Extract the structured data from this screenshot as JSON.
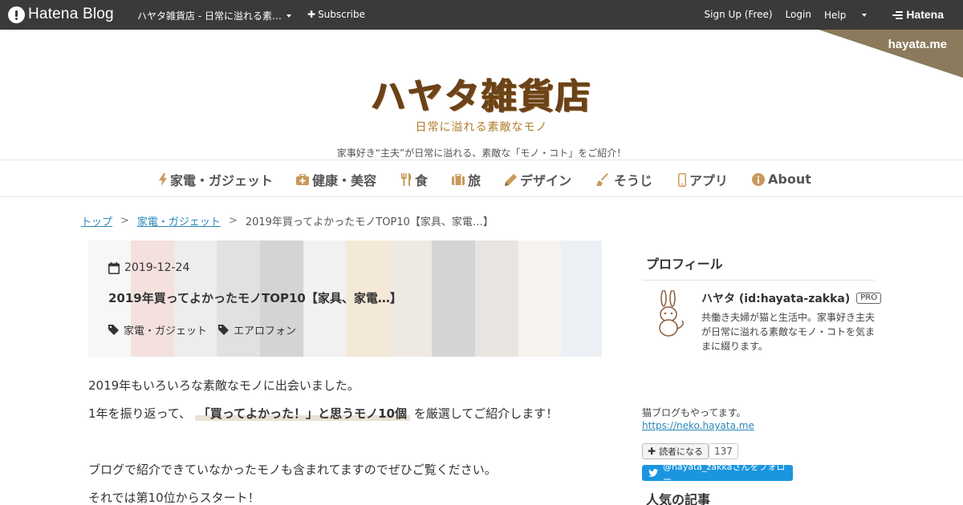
{
  "topbar": {
    "logo_text": "Hatena Blog",
    "blog_name": "ハヤタ雑貨店 - 日常に溢れる素…",
    "subscribe_label": "Subscribe",
    "signup_label": "Sign Up (Free)",
    "login_label": "Login",
    "help_label": "Help",
    "hatena_label": "Hatena"
  },
  "ribbon": {
    "text": "hayata.me"
  },
  "header": {
    "title": "ハヤタ雑貨店",
    "subtitle": "日常に溢れる素敵なモノ",
    "description": "家事好き“主夫”が日常に溢れる、素敵な「モノ・コト」をご紹介！"
  },
  "nav": {
    "items": [
      {
        "label": "家電・ガジェット",
        "icon": "bolt-icon"
      },
      {
        "label": "健康・美容",
        "icon": "medkit-icon"
      },
      {
        "label": "食",
        "icon": "cutlery-icon"
      },
      {
        "label": "旅",
        "icon": "suitcase-icon"
      },
      {
        "label": "デザイン",
        "icon": "pencil-icon"
      },
      {
        "label": "そうじ",
        "icon": "broom-icon"
      },
      {
        "label": "アプリ",
        "icon": "mobile-icon"
      },
      {
        "label": "About",
        "icon": "info-icon"
      }
    ]
  },
  "breadcrumb": {
    "items": [
      "トップ",
      "家電・ガジェット",
      "2019年買ってよかったモノTOP10【家具、家電…】"
    ],
    "separator": ">"
  },
  "article": {
    "date": "2019-12-24",
    "title": "2019年買ってよかったモノTOP10【家具、家電…】",
    "tags": [
      "家電・ガジェット",
      "エアロフォン"
    ],
    "body": {
      "p1": "2019年もいろいろな素敵なモノに出会いました。",
      "p2_pre": "1年を振り返って、",
      "p2_highlight": "「買ってよかった！」と思うモノ10個",
      "p2_post": "を厳選してご紹介します！",
      "p3": "ブログで紹介できていなかったモノも含まれてますのでぜひご覧ください。",
      "p4": "それでは第10位からスタート！"
    }
  },
  "sidebar": {
    "profile_heading": "プロフィール",
    "profile_name": "ハヤタ (id:hayata-zakka)",
    "pro_badge": "PRO",
    "profile_desc": "共働き夫婦が猫と生活中。家事好き主夫が日常に溢れる素敵なモノ・コトを気ままに綴ります。",
    "extra_text": "猫ブログもやってます。",
    "extra_link": "https://neko.hayata.me",
    "reader_button": "読者になる",
    "reader_count": "137",
    "twitter_button": "@hayata_zakkaさんをフォロー",
    "popular_heading": "人気の記事"
  },
  "colors": {
    "topbar_bg": "#3a3a3a",
    "accent_brown": "#6b4318",
    "icon_tan": "#c9995a",
    "link_blue": "#2a87b8",
    "twitter_blue": "#1b95e0",
    "ribbon": "#8c7a5c"
  }
}
